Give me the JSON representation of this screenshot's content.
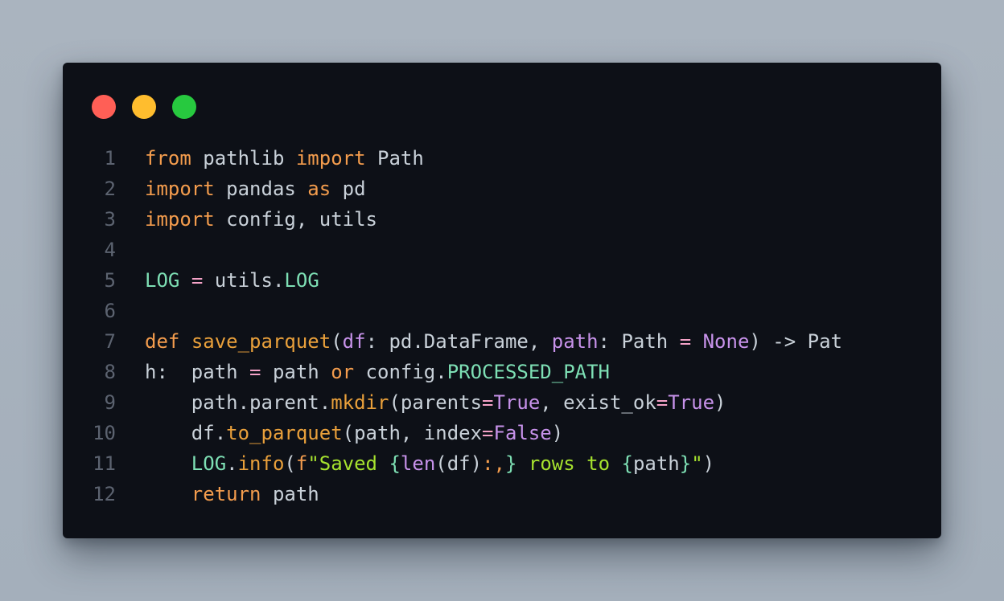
{
  "window_controls": {
    "close_color": "#ff5f56",
    "minimize_color": "#ffbd2e",
    "maximize_color": "#27c93f"
  },
  "colors": {
    "background": "#0d1017",
    "keyword": "#f39c4d",
    "function": "#e9a03b",
    "constant": "#7ee0b5",
    "builtin": "#c792ea",
    "string": "#a6e22e",
    "line_number": "#5c6370",
    "text": "#c9d1d9"
  },
  "code": {
    "lines": [
      {
        "n": "1",
        "tokens": [
          {
            "t": "from",
            "c": "kw"
          },
          {
            "t": " pathlib ",
            "c": "pl"
          },
          {
            "t": "import",
            "c": "kw"
          },
          {
            "t": " Path",
            "c": "pl"
          }
        ]
      },
      {
        "n": "2",
        "tokens": [
          {
            "t": "import",
            "c": "kw"
          },
          {
            "t": " pandas ",
            "c": "pl"
          },
          {
            "t": "as",
            "c": "kw"
          },
          {
            "t": " pd",
            "c": "pl"
          }
        ]
      },
      {
        "n": "3",
        "tokens": [
          {
            "t": "import",
            "c": "kw"
          },
          {
            "t": " config, utils",
            "c": "pl"
          }
        ]
      },
      {
        "n": "4",
        "tokens": []
      },
      {
        "n": "5",
        "tokens": [
          {
            "t": "LOG",
            "c": "cst"
          },
          {
            "t": " ",
            "c": "pl"
          },
          {
            "t": "=",
            "c": "op"
          },
          {
            "t": " utils.",
            "c": "pl"
          },
          {
            "t": "LOG",
            "c": "cst"
          }
        ]
      },
      {
        "n": "6",
        "tokens": []
      },
      {
        "n": "7",
        "tokens": [
          {
            "t": "def",
            "c": "kw"
          },
          {
            "t": " ",
            "c": "pl"
          },
          {
            "t": "save_parquet",
            "c": "fn"
          },
          {
            "t": "(",
            "c": "pl"
          },
          {
            "t": "df",
            "c": "bi"
          },
          {
            "t": ": pd.DataFrame, ",
            "c": "pl"
          },
          {
            "t": "path",
            "c": "bi"
          },
          {
            "t": ": Path ",
            "c": "pl"
          },
          {
            "t": "=",
            "c": "op"
          },
          {
            "t": " ",
            "c": "pl"
          },
          {
            "t": "None",
            "c": "bi"
          },
          {
            "t": ") -> Pat",
            "c": "pl"
          }
        ]
      },
      {
        "n": "8",
        "tokens": [
          {
            "t": "h:  path ",
            "c": "pl"
          },
          {
            "t": "=",
            "c": "op"
          },
          {
            "t": " path ",
            "c": "pl"
          },
          {
            "t": "or",
            "c": "kw"
          },
          {
            "t": " config.",
            "c": "pl"
          },
          {
            "t": "PROCESSED_PATH",
            "c": "cst"
          }
        ]
      },
      {
        "n": "9",
        "tokens": [
          {
            "t": "    path.parent.",
            "c": "pl"
          },
          {
            "t": "mkdir",
            "c": "fn"
          },
          {
            "t": "(parents",
            "c": "pl"
          },
          {
            "t": "=",
            "c": "op"
          },
          {
            "t": "True",
            "c": "bi"
          },
          {
            "t": ", exist_ok",
            "c": "pl"
          },
          {
            "t": "=",
            "c": "op"
          },
          {
            "t": "True",
            "c": "bi"
          },
          {
            "t": ")",
            "c": "pl"
          }
        ]
      },
      {
        "n": "10",
        "tokens": [
          {
            "t": "    df.",
            "c": "pl"
          },
          {
            "t": "to_parquet",
            "c": "fn"
          },
          {
            "t": "(path, index",
            "c": "pl"
          },
          {
            "t": "=",
            "c": "op"
          },
          {
            "t": "False",
            "c": "bi"
          },
          {
            "t": ")",
            "c": "pl"
          }
        ]
      },
      {
        "n": "11",
        "tokens": [
          {
            "t": "    ",
            "c": "pl"
          },
          {
            "t": "LOG",
            "c": "cst"
          },
          {
            "t": ".",
            "c": "pl"
          },
          {
            "t": "info",
            "c": "fn"
          },
          {
            "t": "(",
            "c": "pl"
          },
          {
            "t": "f",
            "c": "kw"
          },
          {
            "t": "\"Saved ",
            "c": "str"
          },
          {
            "t": "{",
            "c": "cst"
          },
          {
            "t": "len",
            "c": "bi"
          },
          {
            "t": "(df)",
            "c": "pl"
          },
          {
            "t": ":,",
            "c": "kw"
          },
          {
            "t": "}",
            "c": "cst"
          },
          {
            "t": " rows to ",
            "c": "str"
          },
          {
            "t": "{",
            "c": "cst"
          },
          {
            "t": "path",
            "c": "pl"
          },
          {
            "t": "}",
            "c": "cst"
          },
          {
            "t": "\"",
            "c": "str"
          },
          {
            "t": ")",
            "c": "pl"
          }
        ]
      },
      {
        "n": "12",
        "tokens": [
          {
            "t": "    ",
            "c": "pl"
          },
          {
            "t": "return",
            "c": "kw"
          },
          {
            "t": " path",
            "c": "pl"
          }
        ]
      }
    ]
  }
}
